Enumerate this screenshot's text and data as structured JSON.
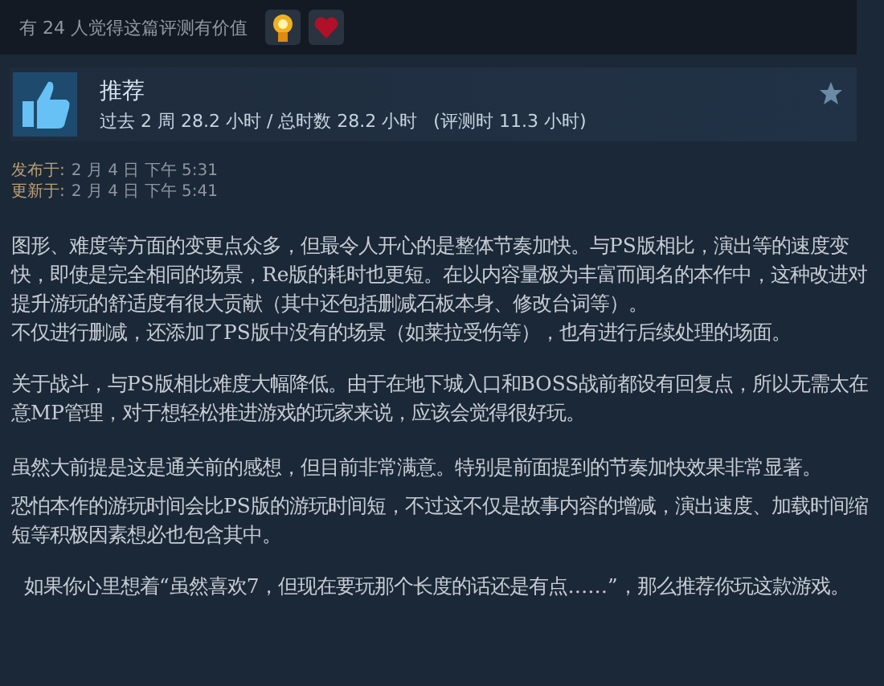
{
  "helpful": {
    "text": "有 24 人觉得这篇评测有价值",
    "awards": [
      {
        "kind": "medal"
      },
      {
        "kind": "heart"
      }
    ]
  },
  "review": {
    "verdict": "推荐",
    "recommended": true,
    "hours": "过去 2 周 28.2 小时 / 总时数 28.2 小时",
    "review_hours": "(评测时 11.3 小时)"
  },
  "dates": [
    {
      "label": "发布于:",
      "value": "2 月 4 日 下午 5:31"
    },
    {
      "label": "更新于:",
      "value": "2 月 4 日 下午 5:41"
    }
  ],
  "paragraphs": [
    {
      "text": "图形、难度等方面的变更点众多，但最令人开心的是整体节奏加快。与PS版相比，演出等的速度变快，即使是完全相同的场景，Re版的耗时也更短。在以内容量极为丰富而闻名的本作中，这种改进对提升游玩的舒适度有很大贡献（其中还包括删减石板本身、修改台词等）。"
    },
    {
      "text": "不仅进行删减，还添加了PS版中没有的场景（如莱拉受伤等），也有进行后续处理的场面。"
    },
    {
      "text": "关于战斗，与PS版相比难度大幅降低。由于在地下城入口和BOSS战前都设有回复点，所以无需太在意MP管理，对于想轻松推进游戏的玩家来说，应该会觉得很好玩。"
    },
    {
      "text": "虽然大前提是这是通关前的感想，但目前非常满意。特别是前面提到的节奏加快效果非常显著。"
    },
    {
      "text": "恐怕本作的游玩时间会比PS版的游玩时间短，不过这不仅是故事内容的增减，演出速度、加载时间缩短等积极因素想必也包含其中。"
    },
    {
      "text": "如果你心里想着“虽然喜欢7，但现在要玩那个长度的话还是有点……”，那么推荐你玩这款游戏。"
    }
  ]
}
